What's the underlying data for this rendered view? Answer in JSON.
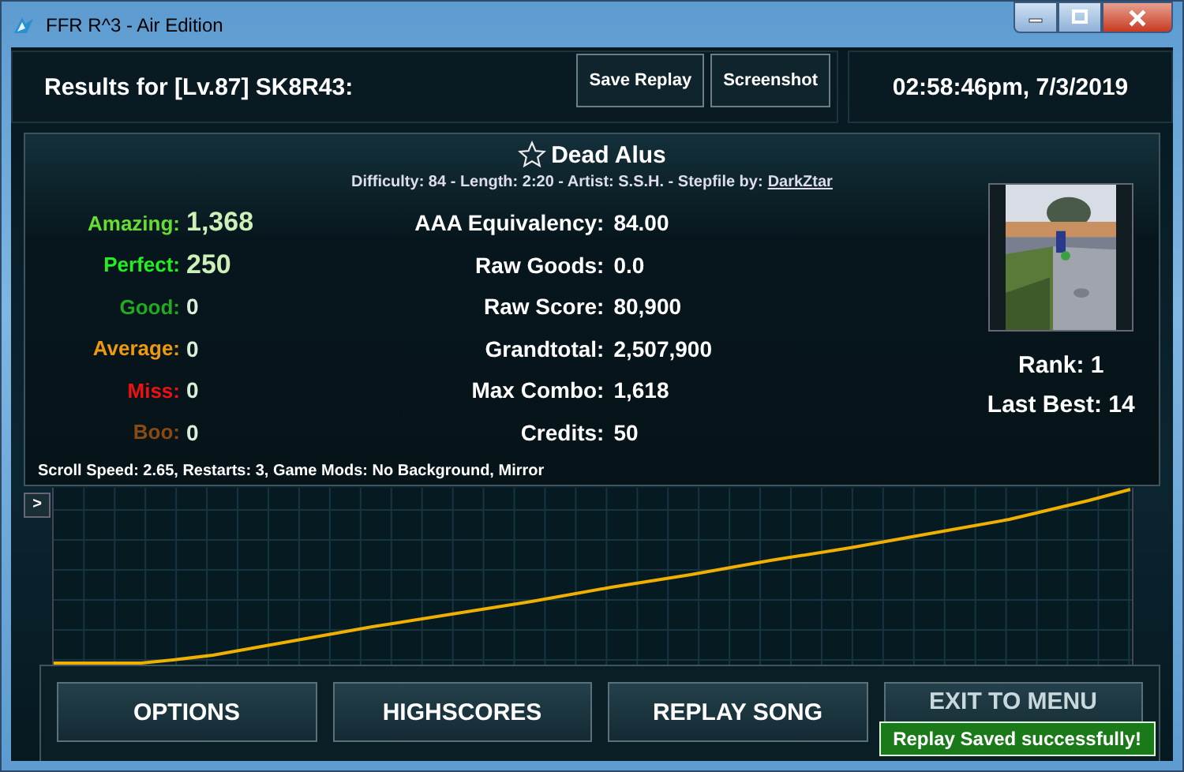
{
  "window": {
    "title": "FFR R^3 - Air Edition"
  },
  "header": {
    "title": "Results for [Lv.87] SK8R43:",
    "buttons": [
      "Save Replay",
      "Screenshot"
    ],
    "datetime": "02:58:46pm, 7/3/2019"
  },
  "song": {
    "title": "Dead Alus",
    "favorite": false,
    "info": "Difficulty: 84 - Length: 2:20 - Artist: S.S.H. - Stepfile by:",
    "stepfile_author": "DarkZtar"
  },
  "judgements": [
    {
      "label": "Amazing:",
      "value": "1,368",
      "color": "#66dd33",
      "kind": "major"
    },
    {
      "label": "Perfect:",
      "value": "250",
      "color": "#22ee22",
      "kind": "major"
    },
    {
      "label": "Good:",
      "value": "0",
      "color": "#22aa22",
      "kind": "minor"
    },
    {
      "label": "Average:",
      "value": "0",
      "color": "#ee9911",
      "kind": "minor"
    },
    {
      "label": "Miss:",
      "value": "0",
      "color": "#ee1111",
      "kind": "minor"
    },
    {
      "label": "Boo:",
      "value": "0",
      "color": "#8a4a14",
      "kind": "minor"
    }
  ],
  "stats": [
    {
      "label": "AAA Equivalency:",
      "value": "84.00"
    },
    {
      "label": "Raw Goods:",
      "value": "0.0"
    },
    {
      "label": "Raw Score:",
      "value": "80,900"
    },
    {
      "label": "Grandtotal:",
      "value": "2,507,900"
    },
    {
      "label": "Max Combo:",
      "value": "1,618"
    },
    {
      "label": "Credits:",
      "value": "50"
    }
  ],
  "rank": "Rank: 1",
  "last_best": "Last Best: 14",
  "settings": "Scroll Speed: 2.65, Restarts: 3, Game Mods: No Background, Mirror",
  "graph": {
    "toggle": ">"
  },
  "buttons": [
    "OPTIONS",
    "HIGHSCORES",
    "REPLAY SONG",
    "EXIT TO MENU"
  ],
  "toast": "Replay Saved successfully!"
}
